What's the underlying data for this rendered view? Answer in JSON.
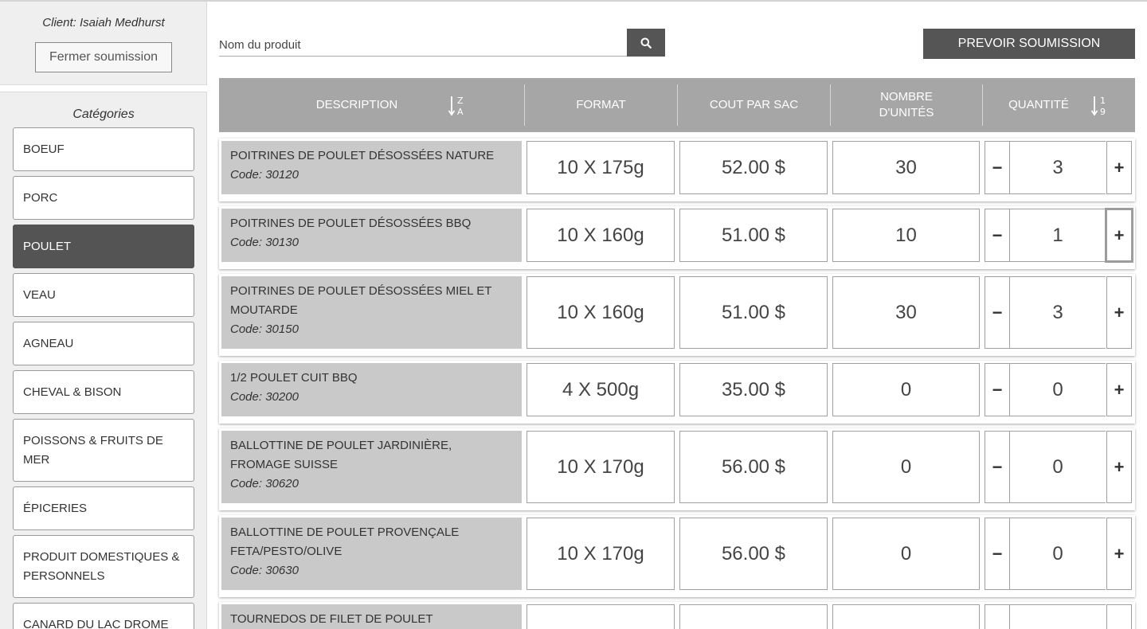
{
  "client": {
    "label": "Client: Isaiah Medhurst",
    "close_label": "Fermer soumission"
  },
  "categories": {
    "title": "Catégories",
    "items": [
      {
        "label": "BOEUF",
        "active": false
      },
      {
        "label": "PORC",
        "active": false
      },
      {
        "label": "POULET",
        "active": true
      },
      {
        "label": "VEAU",
        "active": false
      },
      {
        "label": "AGNEAU",
        "active": false
      },
      {
        "label": "CHEVAL & BISON",
        "active": false
      },
      {
        "label": "POISSONS & FRUITS DE MER",
        "active": false
      },
      {
        "label": "ÉPICERIES",
        "active": false
      },
      {
        "label": "PRODUIT DOMESTIQUES & PERSONNELS",
        "active": false
      },
      {
        "label": "CANARD DU LAC DROME",
        "active": false
      }
    ]
  },
  "search": {
    "placeholder": "Nom du produit",
    "value": "",
    "icon": "search-icon"
  },
  "preview_button": "PREVOIR SOUMISSION",
  "table": {
    "headers": {
      "description": "DESCRIPTION",
      "format": "FORMAT",
      "cost": "COUT PAR SAC",
      "units_line1": "NOMBRE",
      "units_line2": "D'UNITÉS",
      "quantity": "QUANTITÉ"
    },
    "sort_icons": {
      "description": "sort-alpha-desc-icon",
      "quantity": "sort-numeric-asc-icon"
    },
    "minus_label": "−",
    "plus_label": "+",
    "rows": [
      {
        "name": "POITRINES DE POULET DÉSOSSÉES NATURE",
        "code": "Code: 30120",
        "format": "10 X 175g",
        "cost": "52.00 $",
        "units": "30",
        "qty": "3"
      },
      {
        "name": "POITRINES DE POULET DÉSOSSÉES BBQ",
        "code": "Code: 30130",
        "format": "10 X 160g",
        "cost": "51.00 $",
        "units": "10",
        "qty": "1"
      },
      {
        "name": "POITRINES DE POULET DÉSOSSÉES MIEL ET MOUTARDE",
        "code": "Code: 30150",
        "format": "10 X 160g",
        "cost": "51.00 $",
        "units": "30",
        "qty": "3"
      },
      {
        "name": "1/2 POULET CUIT BBQ",
        "code": "Code: 30200",
        "format": "4 X 500g",
        "cost": "35.00 $",
        "units": "0",
        "qty": "0"
      },
      {
        "name": "BALLOTTINE DE POULET JARDINIÈRE, FROMAGE SUISSE",
        "code": "Code: 30620",
        "format": "10 X 170g",
        "cost": "56.00 $",
        "units": "0",
        "qty": "0"
      },
      {
        "name": "BALLOTTINE DE POULET PROVENÇALE FETA/PESTO/OLIVE",
        "code": "Code: 30630",
        "format": "10 X 170g",
        "cost": "56.00 $",
        "units": "0",
        "qty": "0"
      },
      {
        "name": "TOURNEDOS DE FILET DE POULET",
        "code": "",
        "format": "",
        "cost": "",
        "units": "",
        "qty": ""
      }
    ]
  },
  "colors": {
    "header_bg": "#a6a6a6",
    "dark_button": "#555555",
    "active_category": "#545454",
    "desc_bg": "#c9c9c9"
  }
}
